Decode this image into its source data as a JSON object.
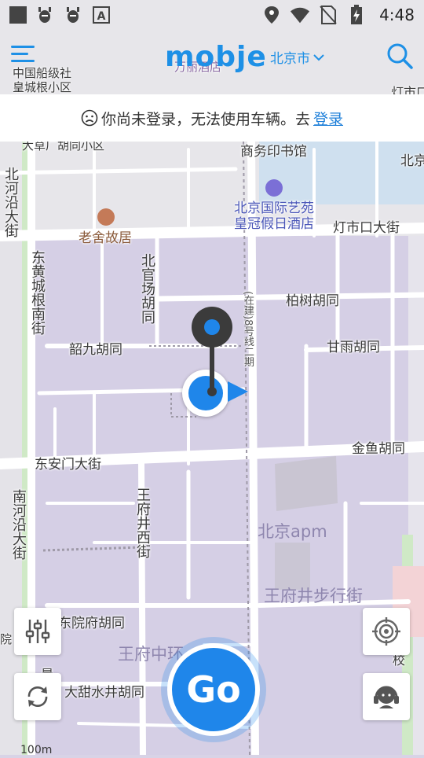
{
  "status_bar": {
    "time": "4:48",
    "icons": [
      "square-icon",
      "bug-icon",
      "bug-icon",
      "font-a-icon",
      "location-icon",
      "wifi-icon",
      "no-sim-icon",
      "battery-charging-icon"
    ]
  },
  "header": {
    "menu_icon": "hamburger-menu-icon",
    "logo_text": "mobje",
    "city": "北京市",
    "search_icon": "search-icon"
  },
  "banner": {
    "message": "你尚未登录，无法使用车辆。去",
    "link": "登录",
    "icon": "sad-face-icon"
  },
  "map": {
    "labels": {
      "l1": "中国船级社",
      "l2": "皇城根小区",
      "l3": "万丽酒店",
      "l4": "灯市口",
      "l5": "大草厂胡同小区",
      "l6": "商务印书馆",
      "l7": "北京",
      "l8": "北京国际艺苑",
      "l9": "皇冠假日酒店",
      "l10": "灯市口大街",
      "l11": "老舍故居",
      "l12": "北河沿大街",
      "l13": "东黄城根南街",
      "l14": "北官场胡同",
      "l15": "柏树胡同",
      "l16": "(在建)8号线二期",
      "l17": "韶九胡同",
      "l18": "甘雨胡同",
      "l19": "金鱼胡同",
      "l20": "东安门大街",
      "l21": "王府井西街",
      "l22": "南河沿大街",
      "l23": "北京apm",
      "l24": "王府井步行街",
      "l25": "东院府胡同",
      "l26": "王府中环",
      "l27": "大甜水井胡同",
      "l28": "院",
      "l29": "校",
      "l30": "晨"
    },
    "scale": "100m"
  },
  "controls": {
    "filter_icon": "sliders-icon",
    "locate_icon": "crosshair-icon",
    "refresh_icon": "refresh-icon",
    "service_icon": "customer-service-icon",
    "go_label": "Go"
  },
  "colors": {
    "accent": "#1e90e6",
    "map_purple": "#d8d3e6",
    "green_strip": "#cfe9c6"
  }
}
